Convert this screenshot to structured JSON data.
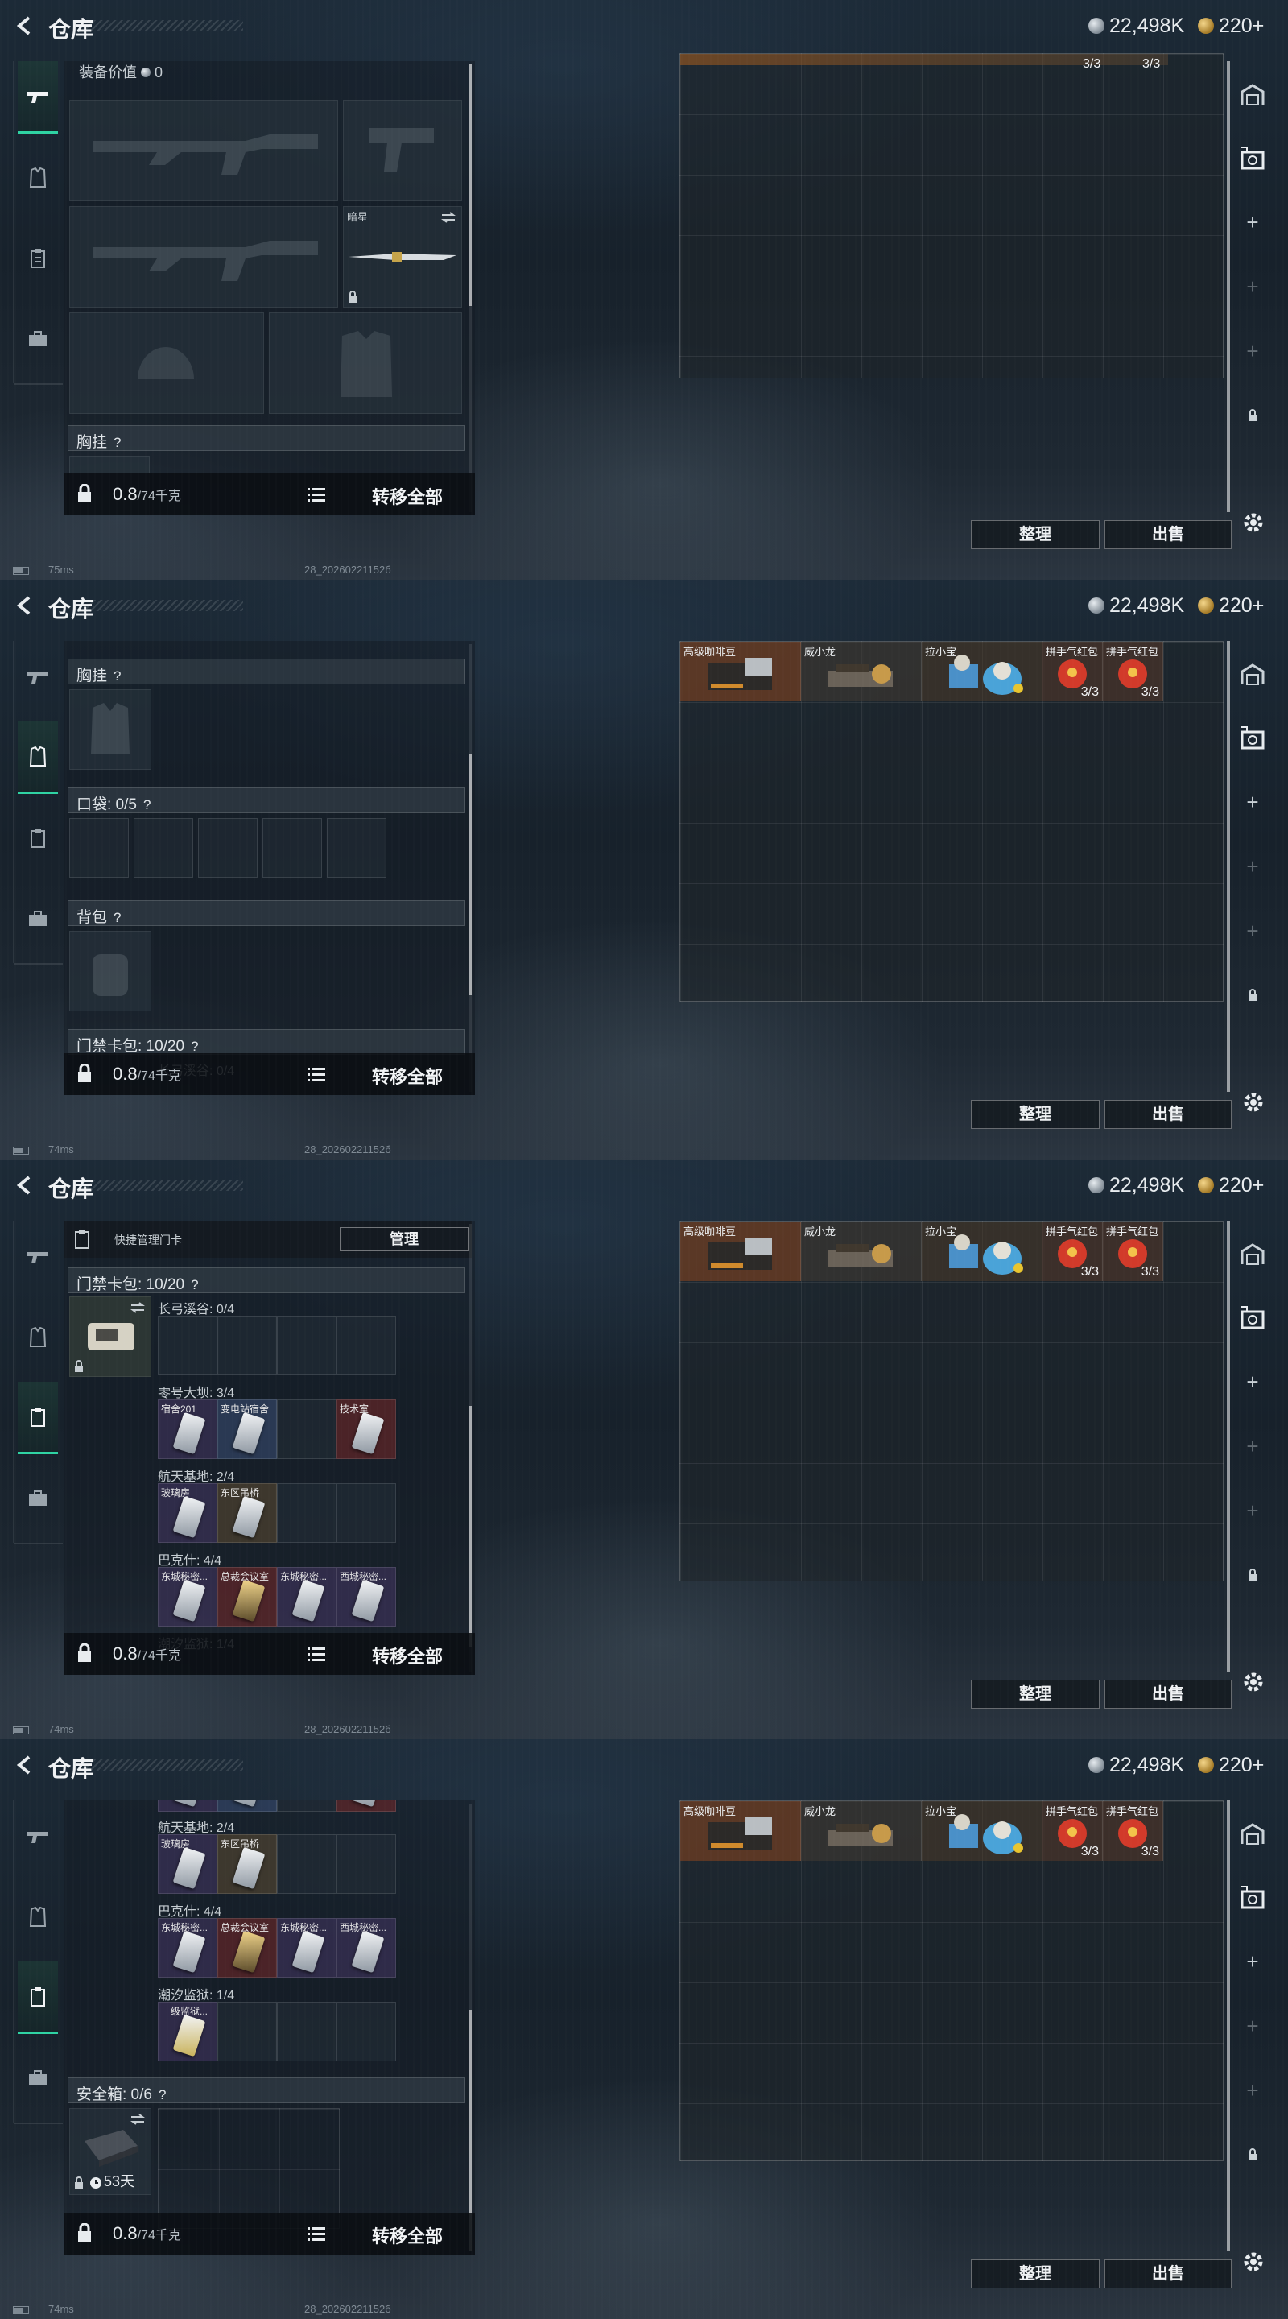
{
  "app": {
    "title": "仓库",
    "currency_silver": "22,498K",
    "currency_gold": "220+"
  },
  "colors": {
    "accent": "#2fd3a3",
    "panel_bg": "#141c24"
  },
  "status": {
    "ping": [
      "75ms",
      "74ms",
      "74ms",
      "74ms"
    ],
    "build": "28_20260221152б"
  },
  "left": {
    "equip_value_label": "装备价值",
    "equip_value": "0",
    "melee_name": "暗星",
    "chest_label": "胸挂",
    "pocket_label": "口袋: 0/5",
    "backpack_label": "背包",
    "keycard_label": "门禁卡包: 10/20",
    "quick_manage_label": "快捷管理门卡",
    "manage_button": "管理",
    "zone1": "长弓溪谷: 0/4",
    "zone2": "零号大坝: 3/4",
    "zone3": "航天基地: 2/4",
    "zone4": "巴克什: 4/4",
    "zone5": "潮汐监狱: 1/4",
    "zone2_cards": [
      "宿舍201",
      "变电站宿舍",
      "",
      "技术室"
    ],
    "zone3_cards": [
      "玻璃房",
      "东区吊桥",
      "",
      ""
    ],
    "zone4_cards": [
      "东城秘密...",
      "总裁会议室",
      "东城秘密...",
      "西城秘密..."
    ],
    "zone5_cards": [
      "一级监狱...",
      "",
      "",
      ""
    ],
    "safe_label": "安全箱: 0/6",
    "safe_days": "53天",
    "weight_value": "0.8",
    "weight_max": "/74千克",
    "transfer_all": "转移全部"
  },
  "right": {
    "items": [
      {
        "name": "高级咖啡豆",
        "count": ""
      },
      {
        "name": "威小龙",
        "count": ""
      },
      {
        "name": "拉小宝",
        "count": ""
      },
      {
        "name": "拼手气红包",
        "count": "3/3"
      },
      {
        "name": "拼手气红包",
        "count": "3/3"
      }
    ],
    "sort_button": "整理",
    "sell_button": "出售"
  }
}
